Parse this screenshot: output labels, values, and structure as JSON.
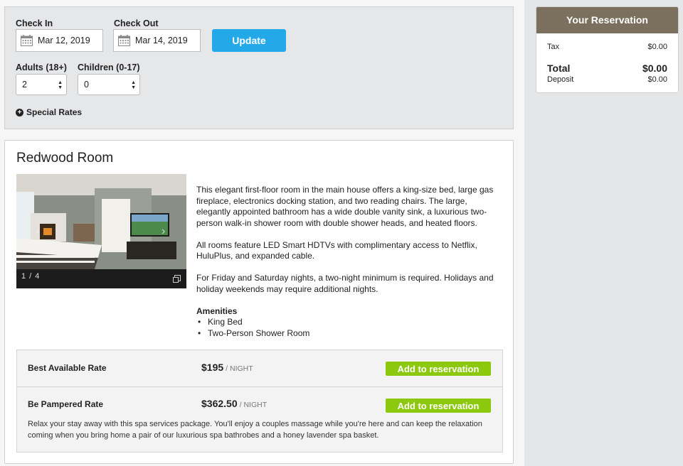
{
  "search": {
    "check_in_label": "Check In",
    "check_in_value": "Mar 12, 2019",
    "check_out_label": "Check Out",
    "check_out_value": "Mar 14, 2019",
    "update_label": "Update",
    "adults_label": "Adults (18+)",
    "adults_value": "2",
    "children_label": "Children (0-17)",
    "children_value": "0",
    "special_rates_label": "Special Rates"
  },
  "room": {
    "title": "Redwood Room",
    "photo_counter": "1 / 4",
    "paragraphs": [
      "This elegant first-floor room in the main house offers a king-size bed, large gas fireplace, electronics docking station, and two reading chairs. The large, elegantly appointed bathroom has a wide double vanity sink, a luxurious two-person walk-in shower room with double shower heads, and heated floors.",
      "All rooms feature LED Smart HDTVs with complimentary access to Netflix, HuluPlus, and expanded cable.",
      "For Friday and Saturday nights, a two-night minimum is required. Holidays and holiday weekends may require additional nights."
    ],
    "amenities_title": "Amenities",
    "amenities": [
      "King Bed",
      "Two-Person Shower Room"
    ]
  },
  "rates": [
    {
      "name": "Best Available Rate",
      "price": "$195",
      "per": "/ NIGHT",
      "button": "Add to reservation"
    },
    {
      "name": "Be Pampered Rate",
      "price": "$362.50",
      "per": "/ NIGHT",
      "button": "Add to reservation",
      "description": "Relax your stay away with this spa services package. You'll enjoy a couples massage while you're here and can keep the relaxation coming when you bring home a pair of our luxurious spa bathrobes and a honey lavender spa basket."
    }
  ],
  "reservation": {
    "title": "Your Reservation",
    "tax_label": "Tax",
    "tax_value": "$0.00",
    "total_label": "Total",
    "total_value": "$0.00",
    "deposit_label": "Deposit",
    "deposit_value": "$0.00"
  },
  "colors": {
    "update_button": "#23a9e8",
    "add_button": "#8cc80d",
    "reservation_header": "#7b6f5d"
  },
  "icons": [
    "calendar-icon",
    "plus-circle-icon",
    "select-arrows-icon",
    "chevron-left-icon",
    "chevron-right-icon",
    "expand-icon"
  ]
}
